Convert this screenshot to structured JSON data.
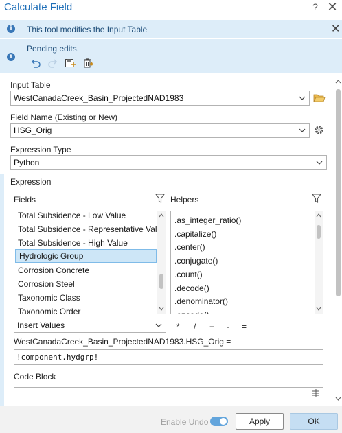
{
  "window": {
    "title": "Calculate Field",
    "help": "?",
    "close": "✕"
  },
  "banners": {
    "modifies": {
      "text": "This tool modifies the Input Table",
      "icon": "info-icon"
    },
    "pending": {
      "text": "Pending edits.",
      "icon": "info-icon",
      "actions": [
        "undo-icon",
        "redo-icon",
        "save-edits-icon",
        "discard-edits-icon"
      ]
    }
  },
  "input_table": {
    "label": "Input Table",
    "value": "WestCanadaCreek_Basin_ProjectedNAD1983"
  },
  "field_name": {
    "label": "Field Name (Existing or New)",
    "value": "HSG_Orig"
  },
  "expression_type": {
    "label": "Expression Type",
    "value": "Python"
  },
  "expression": {
    "label": "Expression",
    "fields_label": "Fields",
    "helpers_label": "Helpers",
    "fields": [
      "Total Subsidence - Low Value",
      "Total Subsidence - Representative Value",
      "Total Subsidence - High Value",
      "Hydrologic Group",
      "Corrosion Concrete",
      "Corrosion Steel",
      "Taxonomic Class",
      "Taxonomic Order"
    ],
    "selected_field": "Hydrologic Group",
    "helpers": [
      ".as_integer_ratio()",
      ".capitalize()",
      ".center()",
      ".conjugate()",
      ".count()",
      ".decode()",
      ".denominator()",
      ".encode()"
    ],
    "insert_mode": "Insert Values",
    "operators": [
      "*",
      "/",
      "+",
      "-",
      "="
    ],
    "target": "WestCanadaCreek_Basin_ProjectedNAD1983.HSG_Orig =",
    "value": "!component.hydgrp!"
  },
  "code_block": {
    "label": "Code Block",
    "value": ""
  },
  "footer": {
    "enable_undo": "Enable Undo",
    "enable_undo_on": true,
    "apply": "Apply",
    "ok": "OK"
  }
}
